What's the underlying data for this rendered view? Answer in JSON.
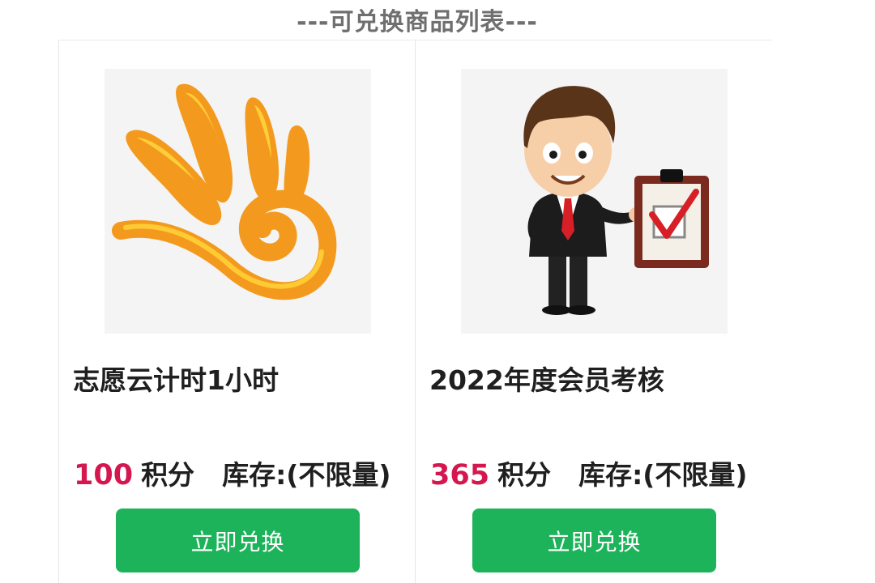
{
  "header": {
    "title": "---可兑换商品列表---"
  },
  "products": [
    {
      "image_icon": "volunteer-hand-logo",
      "name": "志愿云计时1小时",
      "points_value": "100",
      "points_unit": "积分",
      "stock_label": "库存:",
      "stock_value": "(不限量)",
      "redeem_label": "立即兑换"
    },
    {
      "image_icon": "businessman-checklist-illustration",
      "name": "2022年度会员考核",
      "points_value": "365",
      "points_unit": "积分",
      "stock_label": "库存:",
      "stock_value": "(不限量)",
      "redeem_label": "立即兑换"
    }
  ],
  "colors": {
    "points": "#d5174f",
    "button": "#1db35a",
    "title": "#6f6f6f"
  }
}
